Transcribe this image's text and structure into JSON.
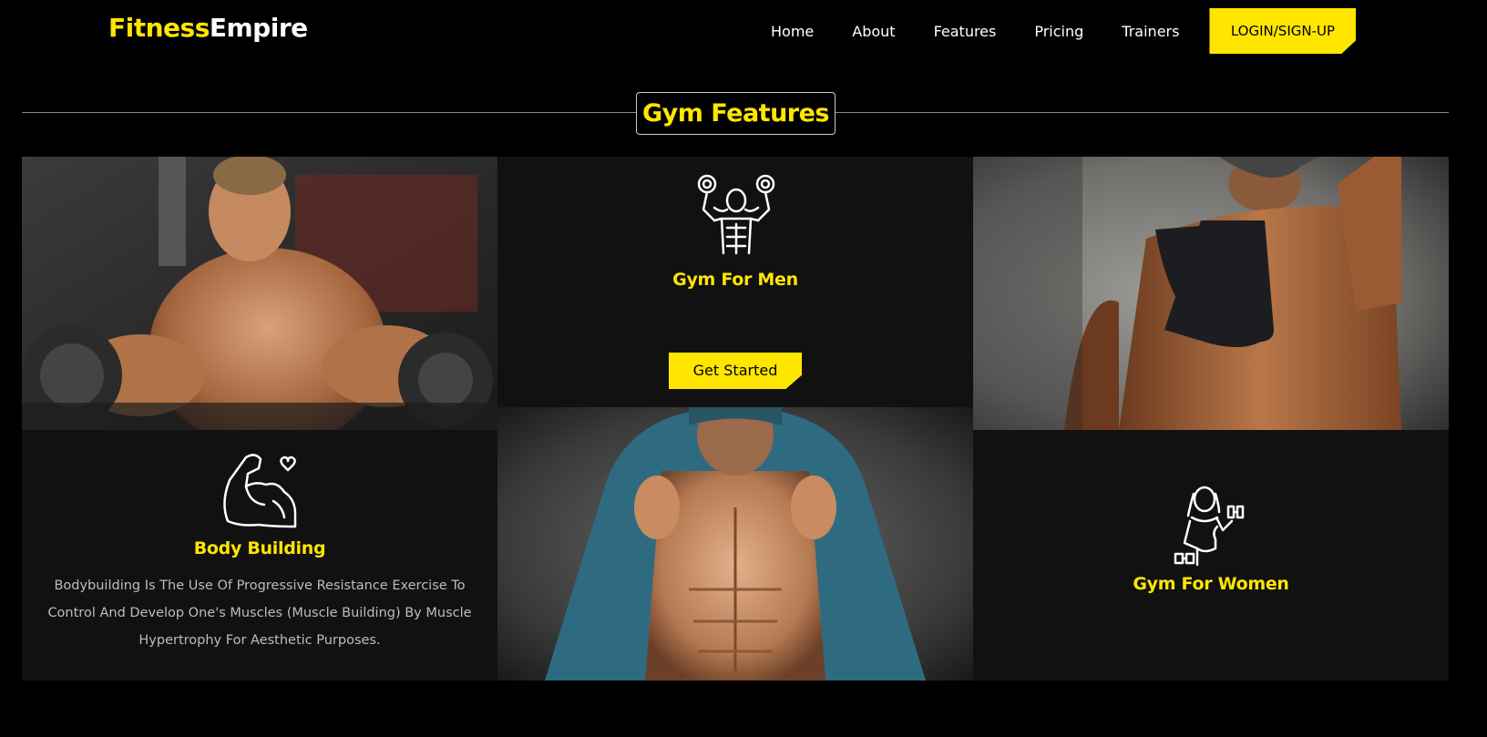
{
  "brand": {
    "part1": "Fitness",
    "part2": "Empire"
  },
  "nav": {
    "items": [
      "Home",
      "About",
      "Features",
      "Pricing",
      "Trainers"
    ],
    "login": "LOGIN/SIGN-UP"
  },
  "section": {
    "title": "Gym Features"
  },
  "features": {
    "men": {
      "title": "Gym For Men",
      "button": "Get Started",
      "icon": "bodybuilder-dumbbells-icon"
    },
    "body_building": {
      "title": "Body Building",
      "description": "Bodybuilding Is The Use Of Progressive Resistance Exercise To Control And Develop One's Muscles (Muscle Building) By Muscle Hypertrophy For Aesthetic Purposes.",
      "icon": "flexed-arm-heart-icon"
    },
    "women": {
      "title": "Gym For Women",
      "icon": "woman-dumbbell-icon"
    }
  },
  "colors": {
    "accent": "#ffe600",
    "background": "#000000",
    "panel": "#111111"
  }
}
